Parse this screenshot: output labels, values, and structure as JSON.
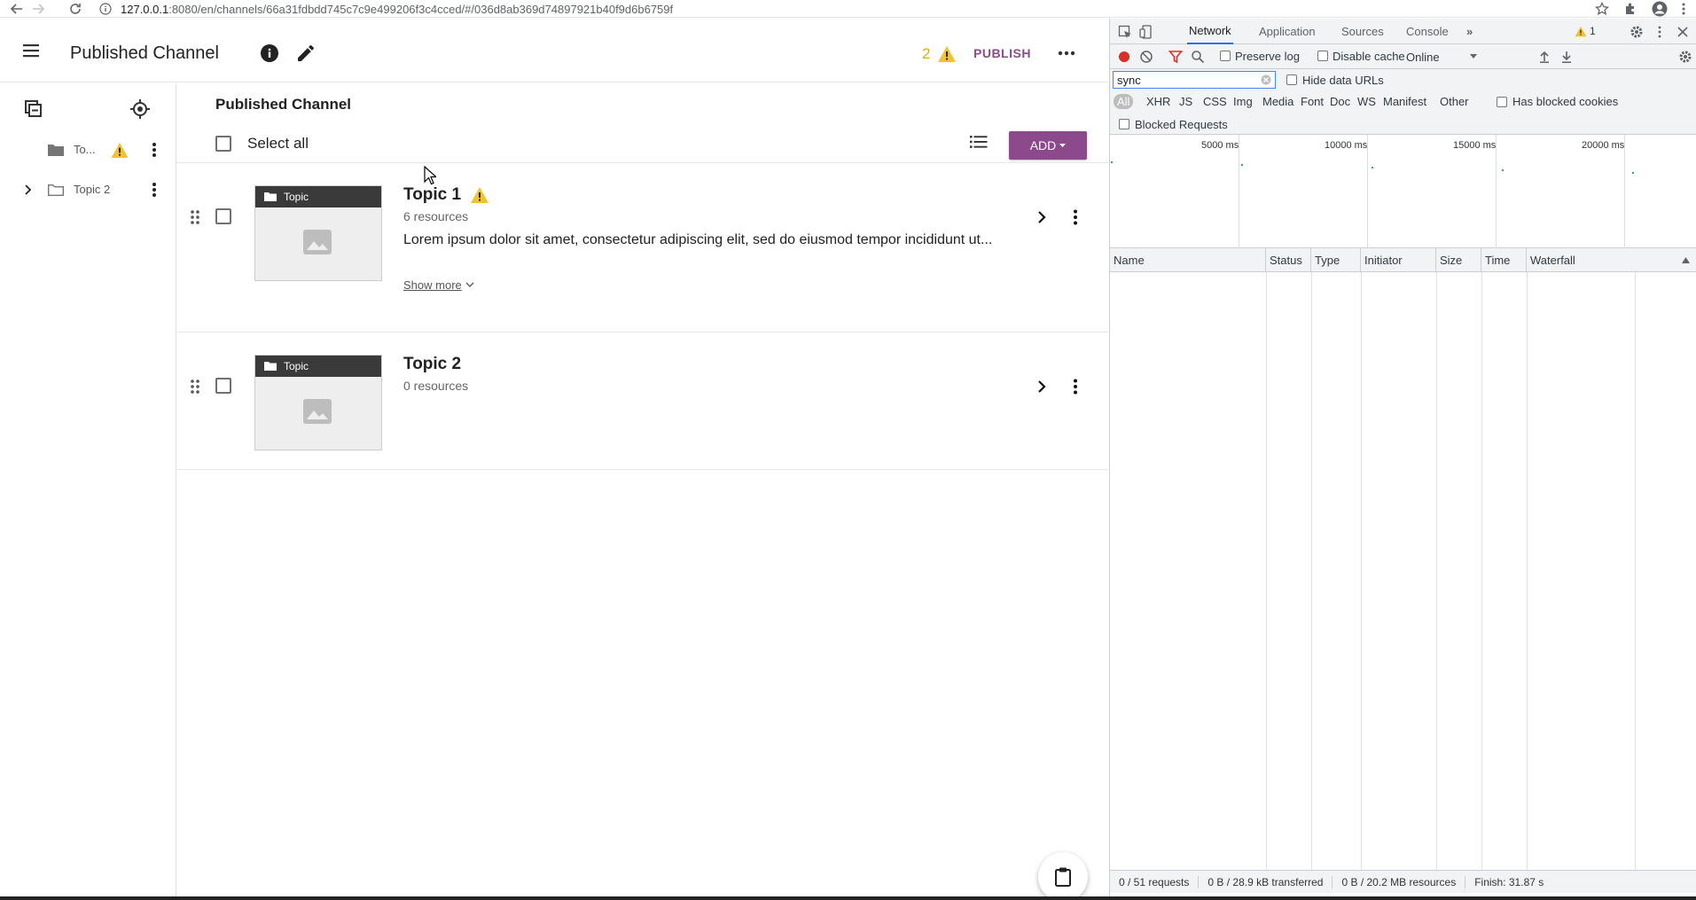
{
  "browser": {
    "url_host": "127.0.0.1",
    "url_rest": ":8080/en/channels/66a31fdbdd745c7c9e499206f3c4cced/#/036d8ab369d74897921b40f9d6b6759f"
  },
  "header": {
    "title": "Published Channel",
    "warning_count": "2",
    "publish_label": "PUBLISH"
  },
  "sidebar": {
    "items": [
      {
        "label": "To..."
      },
      {
        "label": "Topic 2"
      }
    ]
  },
  "main": {
    "title": "Published Channel",
    "select_all_label": "Select all",
    "add_label": "ADD",
    "topics": [
      {
        "badge": "Topic",
        "title": "Topic 1",
        "count": "6 resources",
        "description": "Lorem ipsum dolor sit amet, consectetur adipiscing elit, sed do eiusmod tempor incididunt ut...",
        "show_more": "Show more"
      },
      {
        "badge": "Topic",
        "title": "Topic 2",
        "count": "0 resources"
      }
    ]
  },
  "devtools": {
    "tabs": [
      "Network",
      "Application",
      "Sources",
      "Console"
    ],
    "active_tab": "Network",
    "issues_count": "1",
    "preserve_log": "Preserve log",
    "disable_cache": "Disable cache",
    "throttle": "Online",
    "filter_value": "sync",
    "hide_data_urls": "Hide data URLs",
    "types": [
      "All",
      "XHR",
      "JS",
      "CSS",
      "Img",
      "Media",
      "Font",
      "Doc",
      "WS",
      "Manifest",
      "Other"
    ],
    "has_blocked_cookies": "Has blocked cookies",
    "blocked_requests": "Blocked Requests",
    "timeline_labels": [
      "5000 ms",
      "10000 ms",
      "15000 ms",
      "20000 ms"
    ],
    "columns": [
      "Name",
      "Status",
      "Type",
      "Initiator",
      "Size",
      "Time",
      "Waterfall"
    ],
    "status": {
      "requests": "0 / 51 requests",
      "transferred": "0 B / 28.9 kB transferred",
      "resources": "0 B / 20.2 MB resources",
      "finish": "Finish: 31.87 s"
    }
  },
  "colors": {
    "accent": "#8c4a8c",
    "warning": "#f2c230",
    "devtools_blue": "#1a73e8"
  }
}
